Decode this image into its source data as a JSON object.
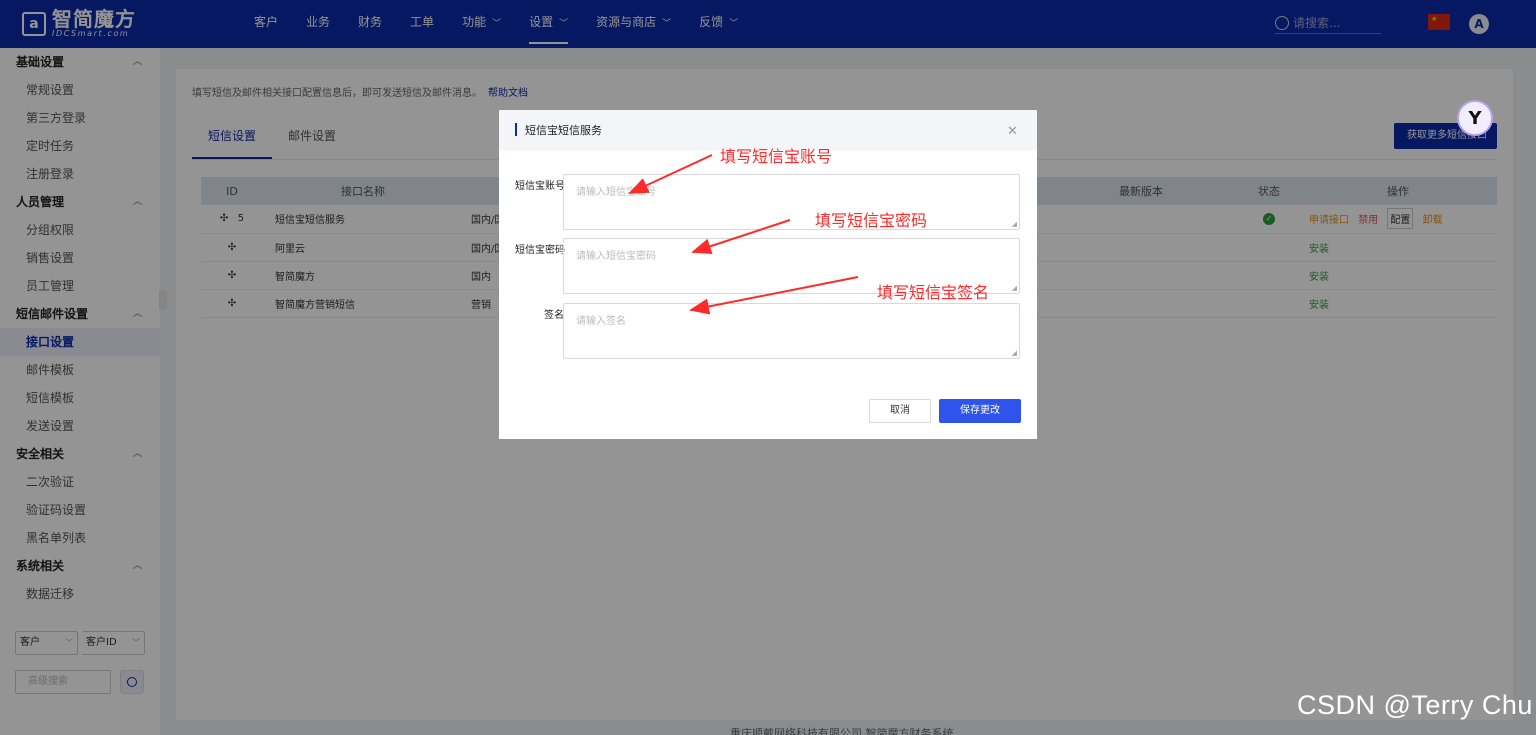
{
  "header": {
    "logo_mark": "a",
    "logo_main": "智简魔方",
    "logo_sub": "IDCSmart.com",
    "nav": [
      {
        "label": "客户",
        "has_menu": false,
        "active": false
      },
      {
        "label": "业务",
        "has_menu": false,
        "active": false
      },
      {
        "label": "财务",
        "has_menu": false,
        "active": false
      },
      {
        "label": "工单",
        "has_menu": false,
        "active": false
      },
      {
        "label": "功能",
        "has_menu": true,
        "active": false
      },
      {
        "label": "设置",
        "has_menu": true,
        "active": true
      },
      {
        "label": "资源与商店",
        "has_menu": true,
        "active": false
      },
      {
        "label": "反馈",
        "has_menu": true,
        "active": false
      }
    ],
    "search_placeholder": "请搜索...",
    "flag_icon": "china-flag-icon",
    "avatar_letter": "A"
  },
  "sidebar": {
    "groups": [
      {
        "label": "基础设置",
        "items": [
          "常规设置",
          "第三方登录",
          "定时任务",
          "注册登录"
        ]
      },
      {
        "label": "人员管理",
        "items": [
          "分组权限",
          "销售设置",
          "员工管理"
        ]
      },
      {
        "label": "短信邮件设置",
        "items": [
          "接口设置",
          "邮件模板",
          "短信模板",
          "发送设置"
        ]
      },
      {
        "label": "安全相关",
        "items": [
          "二次验证",
          "验证码设置",
          "黑名单列表"
        ]
      },
      {
        "label": "系统相关",
        "items": [
          "数据迁移"
        ]
      }
    ],
    "active_item": "接口设置",
    "select_type": "客户",
    "select_field": "客户ID",
    "search_placeholder": "高级搜索"
  },
  "main": {
    "notice": "填写短信及邮件相关接口配置信息后，即可发送短信及邮件消息。",
    "help_link": "帮助文档",
    "tabs": [
      "短信设置",
      "邮件设置"
    ],
    "active_tab": "短信设置",
    "more_button": "获取更多短信接口",
    "table": {
      "headers": [
        "ID",
        "接口名称",
        "",
        "",
        "最新版本",
        "状态",
        "操作"
      ],
      "rows": [
        {
          "id": "5",
          "name": "短信宝短信服务",
          "region": "国内/国",
          "status_ok": true,
          "ops": [
            "申请接口",
            "禁用",
            "配置",
            "卸载"
          ]
        },
        {
          "id": "",
          "name": "阿里云",
          "region": "国内/国",
          "status_ok": false,
          "ops": [
            "安装"
          ]
        },
        {
          "id": "",
          "name": "智简魔方",
          "region": "国内",
          "status_ok": false,
          "ops": [
            "安装"
          ]
        },
        {
          "id": "",
          "name": "智简魔方营销短信",
          "region": "营销",
          "status_ok": false,
          "ops": [
            "安装"
          ]
        }
      ]
    }
  },
  "modal": {
    "title": "短信宝短信服务",
    "fields": [
      {
        "label": "短信宝账号",
        "placeholder": "请输入短信宝账号"
      },
      {
        "label": "短信宝密码",
        "placeholder": "请输入短信宝密码"
      },
      {
        "label": "签名",
        "placeholder": "请输入签名"
      }
    ],
    "cancel": "取消",
    "save": "保存更改"
  },
  "annotations": [
    "填写短信宝账号",
    "填写短信宝密码",
    "填写短信宝签名"
  ],
  "footer": "重庆顺戴网络科技有限公司 智简魔方财务系统",
  "watermark": "CSDN @Terry Chu",
  "colors": {
    "brand": "#0b2aa8",
    "primary_button": "#2f54eb",
    "annotation": "#ff2a2a",
    "status_ok": "#2e9d3e"
  }
}
